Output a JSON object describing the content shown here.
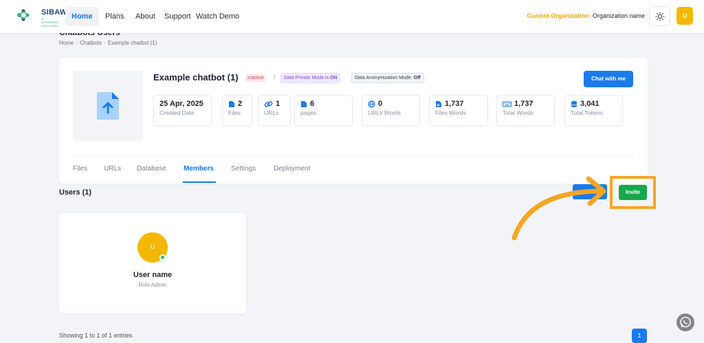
{
  "topnav": {
    "logo_text": "SIBAWAY",
    "logo_sub": "AI INTEGRATED SOLUTIONS",
    "items": [
      {
        "label": "Home",
        "active": true
      },
      {
        "label": "Plans",
        "active": false
      },
      {
        "label": "About",
        "active": false
      },
      {
        "label": "Support",
        "active": false
      },
      {
        "label": "Watch Demo",
        "active": false
      }
    ],
    "org_label": "Current Organization:",
    "org_name": "Organization name",
    "theme_icon": "sun-icon",
    "avatar_letter": "U"
  },
  "page": {
    "title": "Chatbots Users",
    "breadcrumb": [
      "Home",
      "Chatbots",
      "Example chatbot (1)"
    ]
  },
  "chatbot": {
    "name": "Example chatbot (1)",
    "status": "inactive",
    "separator": "/",
    "private_mode_label": "Data Private Mode is",
    "private_mode_value": "ON",
    "anon_mode_label": "Data Anonymization Mode:",
    "anon_mode_value": "Off",
    "chat_button": "Chat with me",
    "thumbnail_icon": "file-upload-icon",
    "stats": [
      {
        "value": "25 Apr, 2025",
        "label": "Created Date",
        "icon": ""
      },
      {
        "value": "2",
        "label": "Files",
        "icon": "file-icon"
      },
      {
        "value": "1",
        "label": "URLs",
        "icon": "link-icon"
      },
      {
        "value": "6",
        "label": "pages",
        "icon": "file-icon"
      },
      {
        "value": "0",
        "label": "URLs Words",
        "icon": "globe-icon"
      },
      {
        "value": "1,737",
        "label": "Files Words",
        "icon": "word-file-icon"
      },
      {
        "value": "1,737",
        "label": "Total Words",
        "icon": "keyboard-icon"
      },
      {
        "value": "3,041",
        "label": "Total Tokens",
        "icon": "database-icon"
      }
    ],
    "tabs": [
      {
        "label": "Files",
        "active": false
      },
      {
        "label": "URLs",
        "active": false
      },
      {
        "label": "Database",
        "active": false
      },
      {
        "label": "Members",
        "active": true
      },
      {
        "label": "Settings",
        "active": false
      },
      {
        "label": "Deployment",
        "active": false
      }
    ]
  },
  "users": {
    "title": "Users (1)",
    "invite_button": "Invite",
    "members": [
      {
        "avatar_letter": "U",
        "name": "User name",
        "role": "Role Admin",
        "online": true
      }
    ],
    "showing": "Showing 1 to 1 of 1 entries",
    "current_page": "1"
  },
  "colors": {
    "accent": "#1a7bec",
    "invite": "#18a84c",
    "highlight": "#f5a623",
    "avatar": "#f5b800"
  }
}
